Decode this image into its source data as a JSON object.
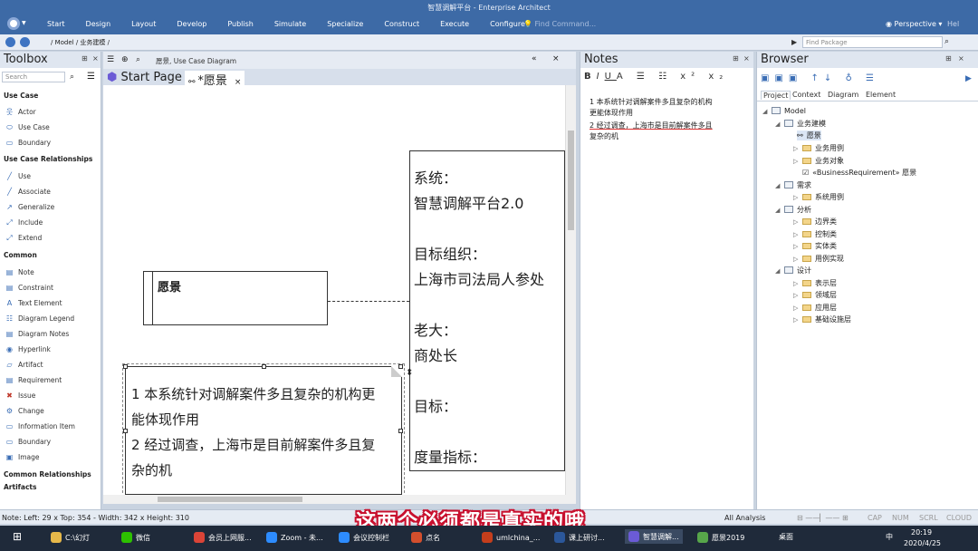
{
  "titlebar": {
    "title": "智慧调解平台 - Enterprise Architect",
    "menu": [
      "Start",
      "Design",
      "Layout",
      "Develop",
      "Publish",
      "Simulate",
      "Specialize",
      "Construct",
      "Execute",
      "Configure"
    ],
    "find_command": "Find Command...",
    "perspective": "Perspective",
    "help": "Hel"
  },
  "address": {
    "path": "/ Model / 业务建模 /",
    "find_package": "Find Package"
  },
  "toolbox": {
    "title": "Toolbox",
    "search": "Search",
    "sections": [
      {
        "label": "Use Case",
        "items": [
          "Actor",
          "Use Case",
          "Boundary"
        ]
      },
      {
        "label": "Use Case Relationships",
        "items": [
          "Use",
          "Associate",
          "Generalize",
          "Include",
          "Extend"
        ]
      },
      {
        "label": "Common",
        "items": [
          "Note",
          "Constraint",
          "Text Element",
          "Diagram Legend",
          "Diagram Notes",
          "Hyperlink",
          "Artifact",
          "Requirement",
          "Issue",
          "Change",
          "Information Item",
          "Boundary",
          "Image"
        ]
      },
      {
        "label": "Common Relationships",
        "items": []
      },
      {
        "label": "Artifacts",
        "items": []
      }
    ]
  },
  "diagram": {
    "breadcrumb": "愿景, Use Case Diagram",
    "tabs": [
      "Start Page",
      "*愿景"
    ],
    "element_title": "愿景",
    "requirement_lines": [
      "系统：",
      "智慧调解平台2.0",
      "",
      "目标组织：",
      "上海市司法局人参处",
      "",
      "老大：",
      "商处长",
      "",
      "目标：",
      "",
      "度量指标："
    ],
    "note_lines": [
      "1 本系统针对调解案件多且复杂的机构更",
      "能体现作用",
      "2 经过调查，上海市是目前解案件多且复",
      "杂的机"
    ]
  },
  "notes": {
    "title": "Notes",
    "lines": [
      "1 本系统针对调解案件多且复杂的机构",
      "更能体现作用",
      "2 经过调查，上海市是目前解案件多且",
      "复杂的机"
    ]
  },
  "browser": {
    "title": "Browser",
    "tabs": [
      "Project",
      "Context",
      "Diagram",
      "Element"
    ],
    "tree": [
      {
        "label": "Model",
        "level": 0,
        "kind": "root"
      },
      {
        "label": "业务建模",
        "level": 1,
        "kind": "pkg"
      },
      {
        "label": "愿景",
        "level": 2,
        "kind": "diagram"
      },
      {
        "label": "业务用例",
        "level": 2,
        "kind": "folder"
      },
      {
        "label": "业务对象",
        "level": 2,
        "kind": "folder"
      },
      {
        "label": "«BusinessRequirement» 愿景",
        "level": 2,
        "kind": "req"
      },
      {
        "label": "需求",
        "level": 1,
        "kind": "pkg"
      },
      {
        "label": "系统用例",
        "level": 2,
        "kind": "folder"
      },
      {
        "label": "分析",
        "level": 1,
        "kind": "pkg"
      },
      {
        "label": "边界类",
        "level": 2,
        "kind": "folder"
      },
      {
        "label": "控制类",
        "level": 2,
        "kind": "folder"
      },
      {
        "label": "实体类",
        "level": 2,
        "kind": "folder"
      },
      {
        "label": "用例实现",
        "level": 2,
        "kind": "folder"
      },
      {
        "label": "设计",
        "level": 1,
        "kind": "pkg"
      },
      {
        "label": "表示层",
        "level": 2,
        "kind": "folder"
      },
      {
        "label": "领域层",
        "level": 2,
        "kind": "folder"
      },
      {
        "label": "应用层",
        "level": 2,
        "kind": "folder"
      },
      {
        "label": "基础设施层",
        "level": 2,
        "kind": "folder"
      }
    ]
  },
  "status": {
    "left": "Note:  Left:   29 x Top:   354 - Width:   342 x Height:   310",
    "analysis": "All Analysis",
    "caps": "CAP",
    "num": "NUM",
    "scrl": "SCRL",
    "cloud": "CLOUD",
    "caption": "这两个必须都是真实的哦"
  },
  "taskbar": {
    "tasks": [
      {
        "label": "C:\\幻灯",
        "color": "#e6b84a"
      },
      {
        "label": "微信",
        "color": "#2dc100"
      },
      {
        "label": "会员上网服...",
        "color": "#db4437"
      },
      {
        "label": "Zoom - 未...",
        "color": "#2d8cff"
      },
      {
        "label": "会议控制栏",
        "color": "#2d8cff"
      },
      {
        "label": "点名",
        "color": "#d34f2d"
      },
      {
        "label": "umlchina_...",
        "color": "#c43e1c"
      },
      {
        "label": "课上研讨...",
        "color": "#2b579a"
      },
      {
        "label": "智慧调解...",
        "color": "#6b5bd6"
      },
      {
        "label": "愿景2019",
        "color": "#57a64a"
      }
    ],
    "desktop": "桌面",
    "ime": "中",
    "time": "20:19",
    "date": "2020/4/25"
  }
}
